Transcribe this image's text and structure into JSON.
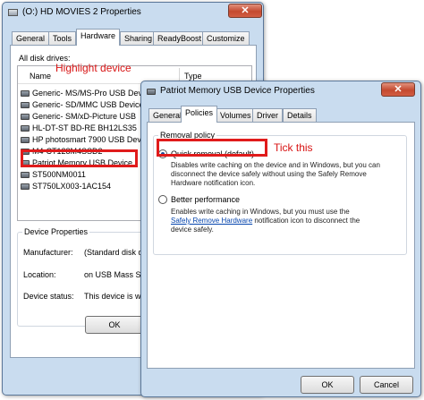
{
  "back_window": {
    "title": "(O:) HD MOVIES 2 Properties",
    "close": "✕",
    "tabs": [
      "General",
      "Tools",
      "Hardware",
      "Sharing",
      "ReadyBoost",
      "Customize"
    ],
    "all_disks_label": "All disk drives:",
    "columns": {
      "name": "Name",
      "type": "Type"
    },
    "devices": [
      "Generic- MS/MS-Pro USB Device",
      "Generic- SD/MMC USB Device",
      "Generic- SM/xD-Picture USB",
      "HL-DT-ST BD-RE  BH12LS35",
      "HP photosmart 7900 USB Device",
      "M4-CT128M4SSD2",
      "Patriot Memory USB Device",
      "ST500NM0011",
      "ST750LX003-1AC154"
    ],
    "device_properties": {
      "group_label": "Device Properties",
      "manufacturer_label": "Manufacturer:",
      "manufacturer_value": "(Standard disk dr",
      "location_label": "Location:",
      "location_value": "on USB Mass St",
      "status_label": "Device status:",
      "status_value": "This device is wo"
    },
    "ok_label": "OK"
  },
  "front_window": {
    "title": "Patriot Memory USB Device Properties",
    "close": "✕",
    "tabs": [
      "General",
      "Policies",
      "Volumes",
      "Driver",
      "Details"
    ],
    "removal_policy_label": "Removal policy",
    "quick_removal": {
      "label": "Quick removal (default)",
      "selected": true,
      "desc1": "Disables write caching on the device and in Windows, but you can",
      "desc2": "disconnect the device safely without using the Safely Remove",
      "desc3": "Hardware notification icon."
    },
    "better_performance": {
      "label": "Better performance",
      "selected": false,
      "desc1": "Enables write caching in Windows, but you must use the",
      "link": "Safely Remove Hardware",
      "desc2_rest": " notification icon to disconnect the",
      "desc3": "device safely."
    },
    "ok_label": "OK",
    "cancel_label": "Cancel"
  },
  "annotations": {
    "highlight_device": "Highlight device",
    "tick_this": "Tick this",
    "color": "#e01b1b"
  }
}
